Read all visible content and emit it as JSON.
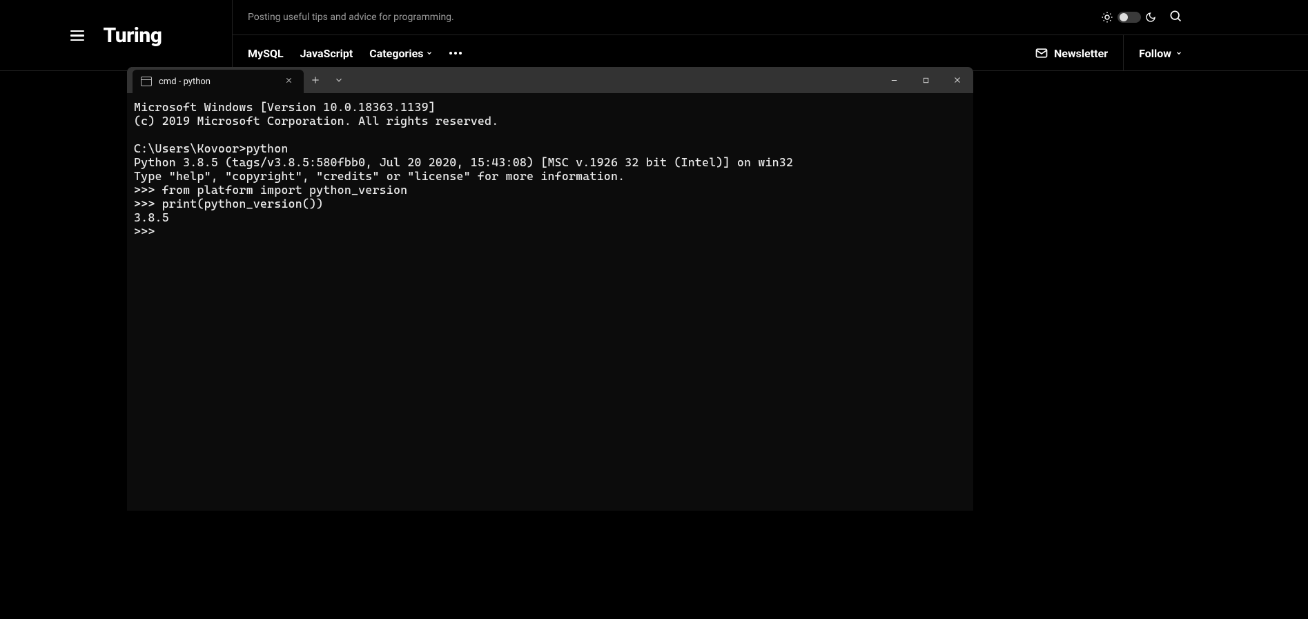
{
  "site": {
    "logo": "Turing",
    "tagline": "Posting useful tips and advice for programming.",
    "nav": {
      "mysql": "MySQL",
      "javascript": "JavaScript",
      "categories": "Categories"
    },
    "newsletter": "Newsletter",
    "follow": "Follow"
  },
  "terminal": {
    "tab_title": "cmd - python",
    "lines": [
      "Microsoft Windows [Version 10.0.18363.1139]",
      "(c) 2019 Microsoft Corporation. All rights reserved.",
      "",
      "C:\\Users\\Kovoor>python",
      "Python 3.8.5 (tags/v3.8.5:580fbb0, Jul 20 2020, 15:43:08) [MSC v.1926 32 bit (Intel)] on win32",
      "Type \"help\", \"copyright\", \"credits\" or \"license\" for more information.",
      ">>> from platform import python_version",
      ">>> print(python_version())",
      "3.8.5",
      ">>> "
    ]
  }
}
